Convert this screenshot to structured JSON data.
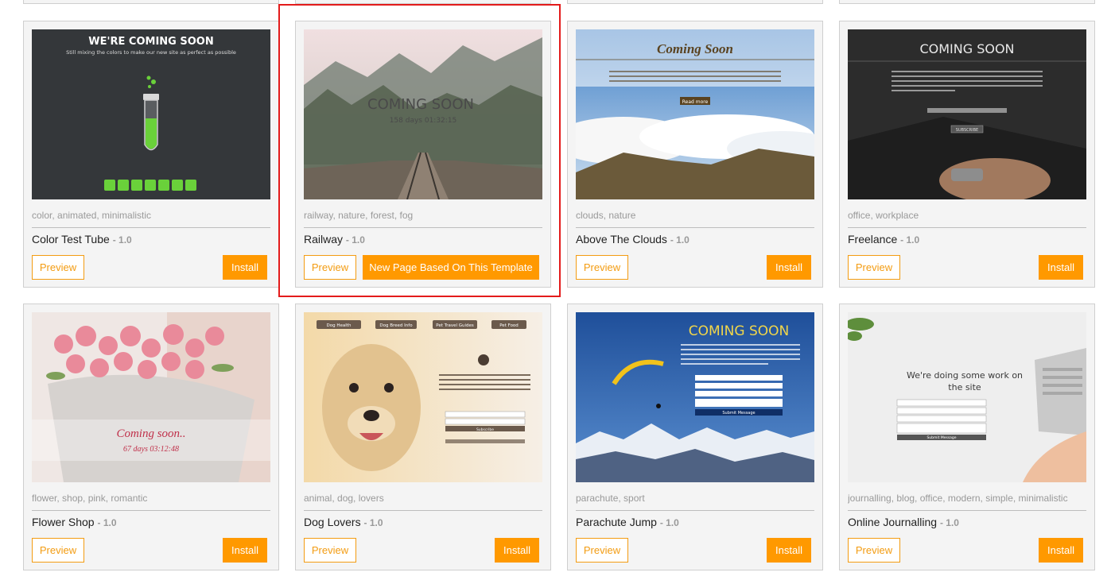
{
  "templates": [
    {
      "tags": "color, animated, minimalistic",
      "name": "Color Test Tube",
      "version": "- 1.0",
      "preview_label": "Preview",
      "install_label": "Install",
      "thumb": {
        "heading": "WE'RE COMING SOON",
        "sub": "Still mixing the colors to make our new site as perfect as possible"
      }
    },
    {
      "tags": "railway, nature, forest, fog",
      "name": "Railway",
      "version": "- 1.0",
      "preview_label": "Preview",
      "new_page_label": "New Page Based On This Template",
      "thumb": {
        "heading": "COMING SOON",
        "sub": "158 days 01:32:15"
      }
    },
    {
      "tags": "clouds, nature",
      "name": "Above The Clouds",
      "version": "- 1.0",
      "preview_label": "Preview",
      "install_label": "Install",
      "thumb": {
        "heading": "Coming Soon",
        "button": "Read more"
      }
    },
    {
      "tags": "office, workplace",
      "name": "Freelance",
      "version": "- 1.0",
      "preview_label": "Preview",
      "install_label": "Install",
      "thumb": {
        "heading": "COMING SOON",
        "button": "SUBSCRIBE"
      }
    },
    {
      "tags": "flower, shop, pink, romantic",
      "name": "Flower Shop",
      "version": "- 1.0",
      "preview_label": "Preview",
      "install_label": "Install",
      "thumb": {
        "heading": "Coming soon..",
        "sub": "67 days 03:12:48"
      }
    },
    {
      "tags": "animal, dog, lovers",
      "name": "Dog Lovers",
      "version": "- 1.0",
      "preview_label": "Preview",
      "install_label": "Install",
      "thumb": {
        "nav": [
          "Dog Health",
          "Dog Breed Info",
          "Pet Travel Guides",
          "Pet Food"
        ],
        "button": "Subscribe"
      }
    },
    {
      "tags": "parachute, sport",
      "name": "Parachute Jump",
      "version": "- 1.0",
      "preview_label": "Preview",
      "install_label": "Install",
      "thumb": {
        "heading": "COMING SOON",
        "button": "Submit Message"
      }
    },
    {
      "tags": "journalling, blog, office, modern, simple, minimalistic",
      "name": "Online Journalling",
      "version": "- 1.0",
      "preview_label": "Preview",
      "install_label": "Install",
      "thumb": {
        "heading_line1": "We're doing some work on",
        "heading_line2": "the site",
        "button": "Submit Message"
      }
    }
  ],
  "colors": {
    "accent": "#ff9900",
    "highlight": "#e31b1b",
    "card_bg": "#f4f4f4"
  }
}
